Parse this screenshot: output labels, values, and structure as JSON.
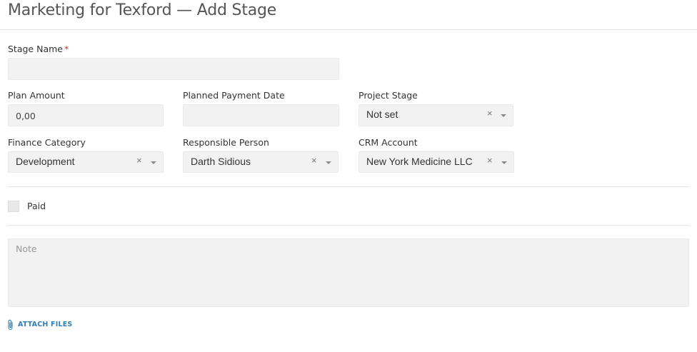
{
  "header": {
    "title": "Marketing for Texford — Add Stage"
  },
  "form": {
    "stage_name": {
      "label": "Stage Name",
      "required_mark": "*",
      "value": ""
    },
    "plan_amount": {
      "label": "Plan Amount",
      "value": "0,00"
    },
    "planned_payment_date": {
      "label": "Planned Payment Date",
      "value": ""
    },
    "project_stage": {
      "label": "Project Stage",
      "value": "Not set"
    },
    "finance_category": {
      "label": "Finance Category",
      "value": "Development"
    },
    "responsible_person": {
      "label": "Responsible Person",
      "value": "Darth Sidious"
    },
    "crm_account": {
      "label": "CRM Account",
      "value": "New York Medicine LLC"
    },
    "paid": {
      "label": "Paid",
      "checked": false
    },
    "note": {
      "placeholder": "Note",
      "value": ""
    },
    "attach_files_label": "ATTACH FILES"
  },
  "icons": {
    "clear": "×"
  },
  "colors": {
    "link": "#2e7fb8",
    "required": "#c0392b",
    "field_bg": "#f2f2f2"
  }
}
